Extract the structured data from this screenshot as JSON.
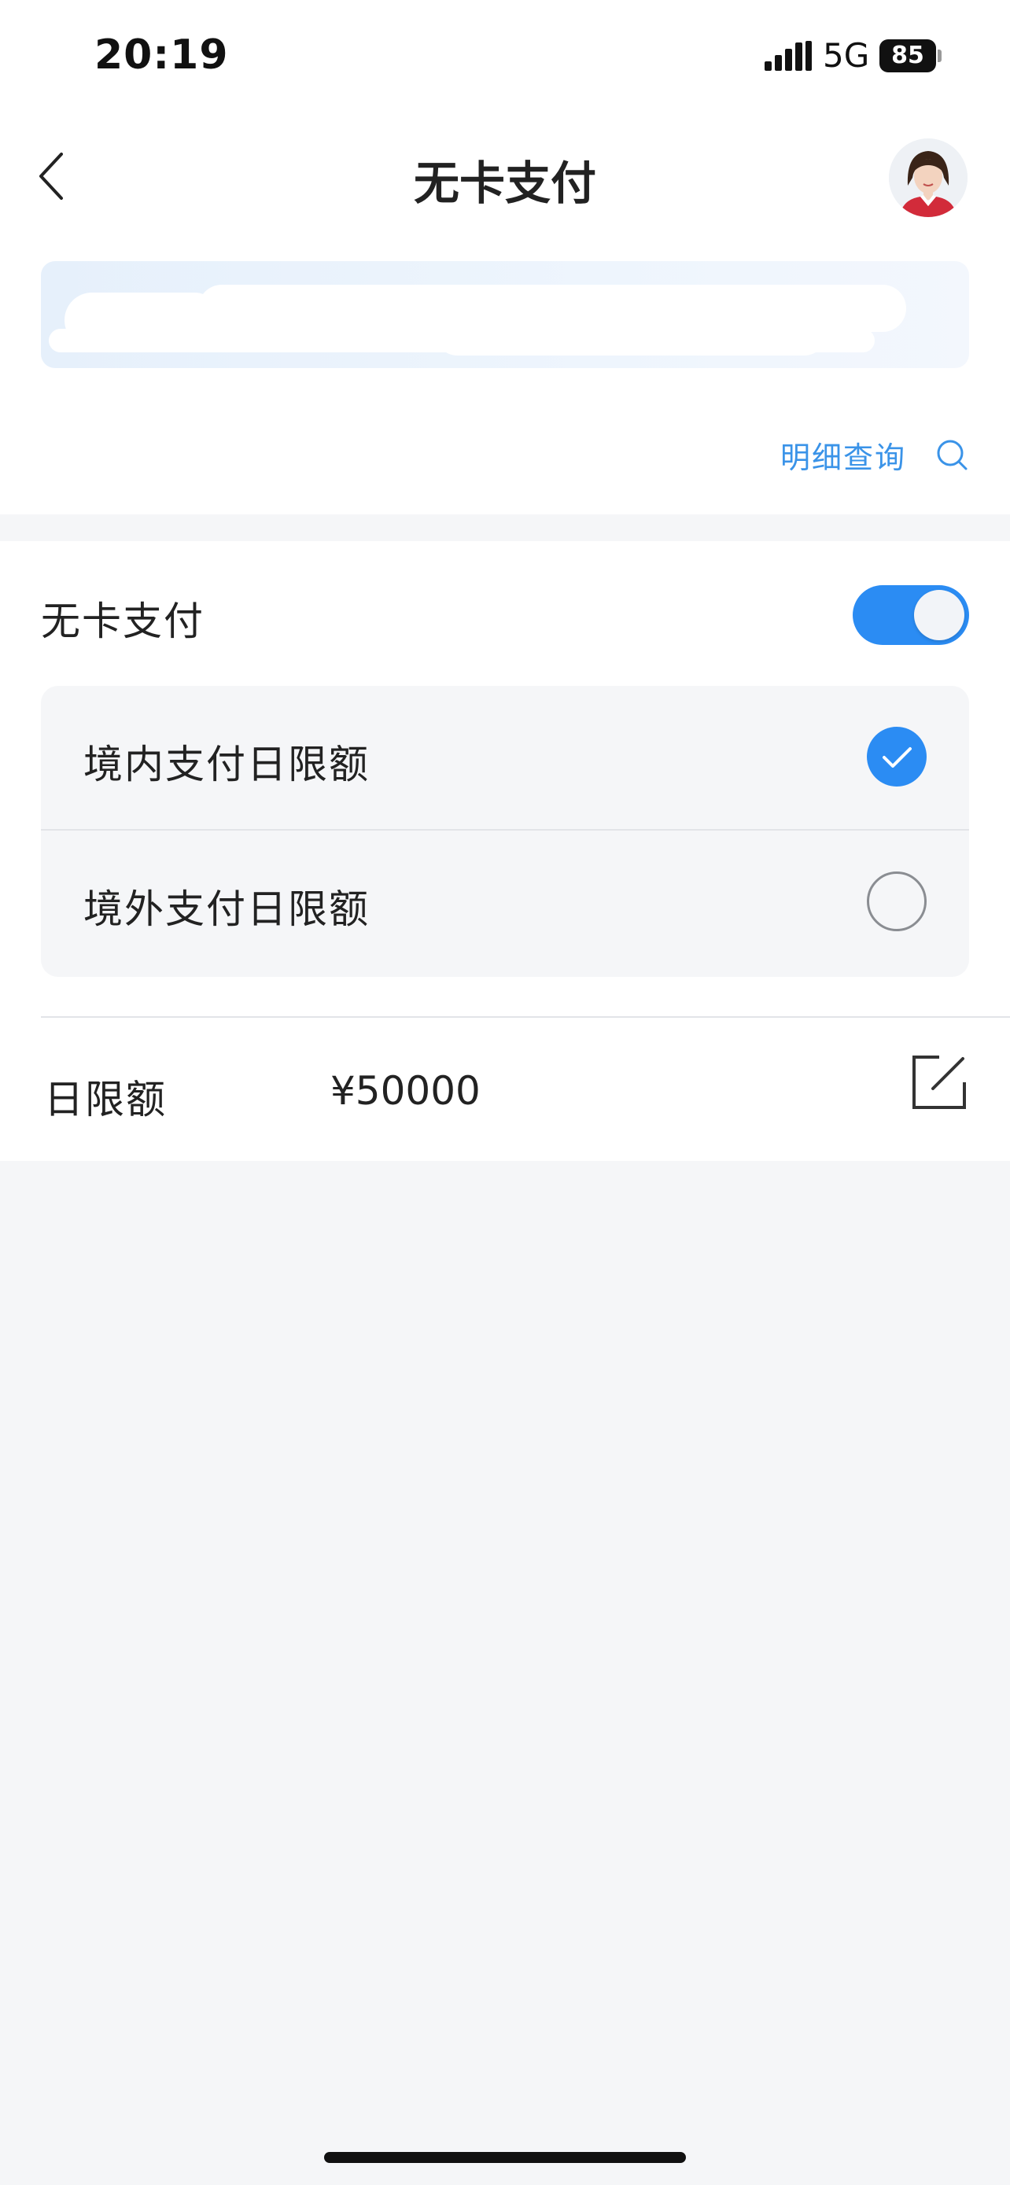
{
  "status_bar": {
    "time": "20:19",
    "network": "5G",
    "battery": "85",
    "icons": [
      "signal-icon",
      "battery-icon"
    ]
  },
  "nav": {
    "title": "无卡支付",
    "icons": [
      "back-icon",
      "avatar"
    ]
  },
  "header": {
    "detail_link_label": "明细查询",
    "detail_link_icon": "search-icon"
  },
  "settings": {
    "toggle": {
      "label": "无卡支付",
      "enabled": true
    },
    "options": [
      {
        "label": "境内支付日限额",
        "selected": true
      },
      {
        "label": "境外支付日限额",
        "selected": false
      }
    ],
    "limit": {
      "label": "日限额",
      "value": "¥50000",
      "edit_icon": "edit-icon"
    }
  },
  "colors": {
    "accent": "#2b8cf3",
    "link": "#3a93e8",
    "background": "#f5f6f8",
    "surface": "#ffffff"
  }
}
